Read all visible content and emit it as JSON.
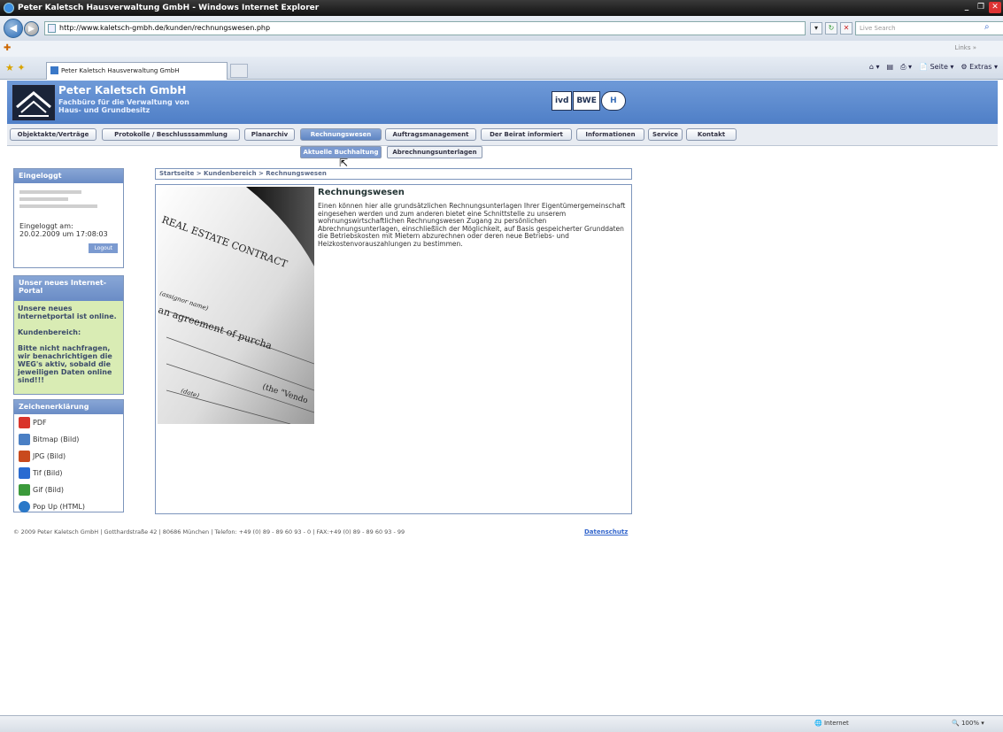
{
  "window": {
    "title": "Peter Kaletsch Hausverwaltung GmbH - Windows Internet Explorer"
  },
  "browser": {
    "url": "http://www.kaletsch-gmbh.de/kunden/rechnungswesen.php",
    "search_placeholder": "Live Search",
    "tab_title": "Peter Kaletsch Hausverwaltung GmbH",
    "links_label": "Links",
    "cmd_page": "Seite",
    "cmd_extras": "Extras",
    "status_zone": "Internet",
    "status_zoom": "100%"
  },
  "header": {
    "company": "Peter Kaletsch GmbH",
    "sub1": "Fachbüro für die Verwaltung von",
    "sub2": "Haus- und Grundbesitz",
    "assoc1": "ivd",
    "assoc2": "BWE",
    "assoc3": "H"
  },
  "nav": {
    "items": [
      {
        "label": "Objektakte/Verträge"
      },
      {
        "label": "Protokolle / Beschlusssammlung"
      },
      {
        "label": "Planarchiv"
      },
      {
        "label": "Rechnungswesen"
      },
      {
        "label": "Auftragsmanagement"
      },
      {
        "label": "Der Beirat informiert"
      },
      {
        "label": "Informationen"
      },
      {
        "label": "Service"
      },
      {
        "label": "Kontakt"
      }
    ],
    "sub": [
      {
        "label": "Aktuelle Buchhaltung"
      },
      {
        "label": "Abrechnungsunterlagen"
      }
    ]
  },
  "login": {
    "title": "Eingeloggt",
    "line1": "Eingeloggt am:",
    "line2": "20.02.2009 um 17:08:03",
    "logout": "Logout"
  },
  "portal": {
    "title": "Unser neues Internet-Portal",
    "p1": "Unsere neues Internetportal ist online.",
    "p2": "Kundenbereich:",
    "p3": "Bitte nicht nachfragen, wir benachrichtigen die WEG's aktiv, sobald die jeweiligen Daten online sind!!!"
  },
  "legend": {
    "title": "Zeichenerklärung",
    "items": [
      {
        "label": "PDF",
        "color": "#d9342b"
      },
      {
        "label": "Bitmap (Bild)",
        "color": "#4a7fc4"
      },
      {
        "label": "JPG (Bild)",
        "color": "#c94a1d"
      },
      {
        "label": "Tif (Bild)",
        "color": "#2a6bd1"
      },
      {
        "label": "Gif (Bild)",
        "color": "#3b9a3b"
      },
      {
        "label": "Pop Up (HTML)",
        "color": "#2a78c8"
      }
    ]
  },
  "breadcrumb": "Startseite > Kundenbereich > Rechnungswesen",
  "content": {
    "title": "Rechnungswesen",
    "text": "Einen können hier alle grundsätzlichen Rechnungsunterlagen Ihrer Eigentümergemeinschaft eingesehen werden und zum anderen bietet eine Schnittstelle zu unserem wohnungswirtschaftlichen Rechnungswesen Zugang zu persönlichen Abrechnungsunterlagen, einschließlich der Möglichkeit, auf Basis gespeicherter Grunddaten die Betriebskosten mit Mietern abzurechnen oder deren neue Betriebs- und Heizkostenvorauszahlungen zu bestimmen.",
    "photo_lines": [
      "REAL ESTATE CONTRACT",
      "(assignor name)",
      "an agreement of purcha",
      "(the \"Vendo",
      "(date)"
    ]
  },
  "footer": {
    "text": "© 2009 Peter Kaletsch GmbH | Gotthardstraße 42 | 80686 München | Telefon: +49 (0) 89 - 89 60 93 - 0 | FAX:+49 (0) 89 - 89 60 93 - 99",
    "link": "Datenschutz"
  }
}
